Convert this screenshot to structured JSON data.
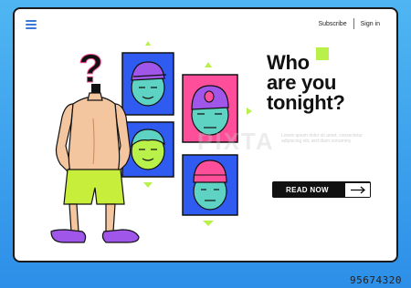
{
  "nav": {
    "subscribe": "Subscribe",
    "sign_in": "Sign in"
  },
  "hero": {
    "headline_lines": [
      "Who",
      "are you",
      "tonight?"
    ],
    "body_text": "Lorem ipsum dolor sit amet, consectetur adipiscing elit, sed diam nonummy",
    "cta_label": "READ NOW"
  },
  "illustration": {
    "question_mark": "?"
  },
  "watermark": {
    "text": "PIXTA"
  },
  "footer": {
    "image_id": "95674320"
  },
  "colors": {
    "accent_blue": "#3a7bd5",
    "card_blue": "#2f5bf0",
    "card_pink": "#ff4f9a",
    "lime": "#b9f04a",
    "purple": "#a056e8",
    "teal": "#5fd3c3"
  }
}
